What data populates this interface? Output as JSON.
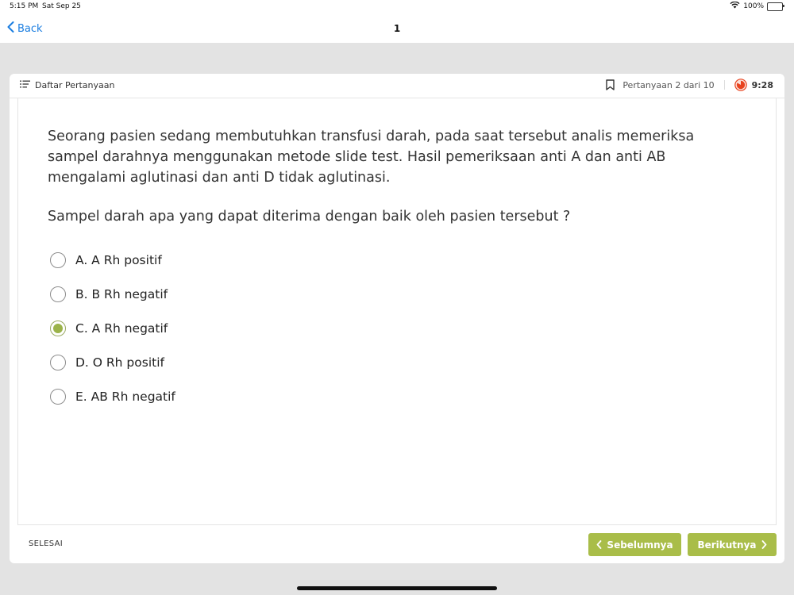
{
  "status_bar": {
    "time": "5:15 PM",
    "date": "Sat Sep 25",
    "battery": "100%"
  },
  "nav": {
    "back_label": "Back",
    "title": "1"
  },
  "card": {
    "list_label": "Daftar Pertanyaan",
    "progress_label": "Pertanyaan 2 dari 10",
    "timer": "9:28"
  },
  "question": {
    "text": "Seorang pasien sedang membutuhkan transfusi darah, pada saat tersebut analis memeriksa sampel darahnya menggunakan metode slide test. Hasil pemeriksaan anti A dan anti AB mengalami aglutinasi dan anti D tidak aglutinasi.",
    "prompt": "Sampel darah apa yang dapat diterima dengan baik oleh pasien tersebut ?",
    "options": [
      {
        "label": "A. A Rh positif",
        "selected": false
      },
      {
        "label": "B. B Rh negatif",
        "selected": false
      },
      {
        "label": "C. A Rh negatif",
        "selected": true
      },
      {
        "label": "D. O Rh positif",
        "selected": false
      },
      {
        "label": "E. AB Rh negatif",
        "selected": false
      }
    ]
  },
  "footer": {
    "finish_label": "SELESAI",
    "prev_label": "Sebelumnya",
    "next_label": "Berikutnya"
  },
  "colors": {
    "accent": "#a9bd49",
    "link": "#1a7de0",
    "timer_icon": "#e8431f"
  },
  "icons": {
    "back": "chevron-left-icon",
    "list": "list-icon",
    "bookmark": "bookmark-icon",
    "timer": "timer-icon",
    "wifi": "wifi-icon"
  }
}
